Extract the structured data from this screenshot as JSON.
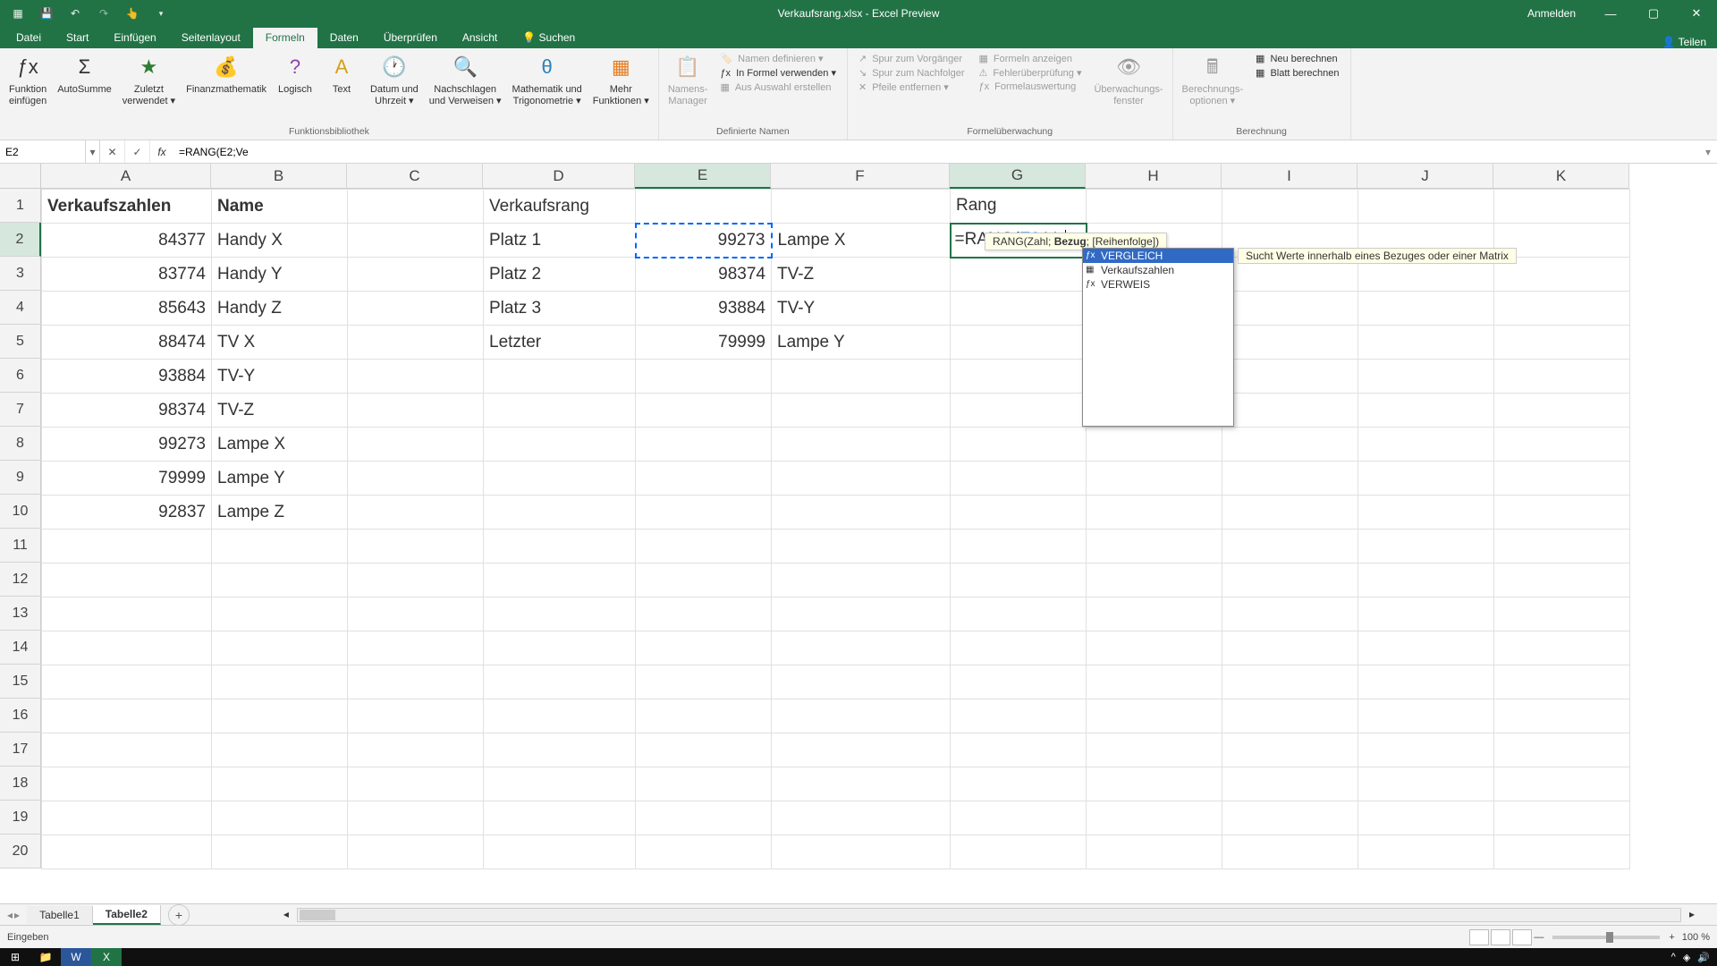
{
  "titlebar": {
    "title": "Verkaufsrang.xlsx - Excel Preview",
    "signin": "Anmelden"
  },
  "ribbonTabs": {
    "file": "Datei",
    "home": "Start",
    "insert": "Einfügen",
    "pageLayout": "Seitenlayout",
    "formulas": "Formeln",
    "data": "Daten",
    "review": "Überprüfen",
    "view": "Ansicht",
    "search": "Suchen",
    "share": "Teilen"
  },
  "ribbon": {
    "insertFn": "Funktion\neinfügen",
    "autosum": "AutoSumme",
    "recent": "Zuletzt\nverwendet ▾",
    "financial": "Finanzmathematik",
    "logical": "Logisch",
    "text": "Text",
    "dateTime": "Datum und\nUhrzeit ▾",
    "lookup": "Nachschlagen\nund Verweisen ▾",
    "mathTrig": "Mathematik und\nTrigonometrie ▾",
    "moreFn": "Mehr\nFunktionen ▾",
    "fnLib": "Funktionsbibliothek",
    "nameMgr": "Namens-\nManager",
    "defineName": "Namen definieren ▾",
    "useInFormula": "In Formel verwenden ▾",
    "createFromSel": "Aus Auswahl erstellen",
    "definedNames": "Definierte Namen",
    "tracePrec": "Spur zum Vorgänger",
    "traceDep": "Spur zum Nachfolger",
    "removeArrows": "Pfeile entfernen ▾",
    "showFormulas": "Formeln anzeigen",
    "errorCheck": "Fehlerüberprüfung ▾",
    "evalFormula": "Formelauswertung",
    "auditing": "Formelüberwachung",
    "watchWin": "Überwachungs-\nfenster",
    "calcOpts": "Berechnungs-\noptionen ▾",
    "calcNow": "Neu berechnen",
    "calcSheet": "Blatt berechnen",
    "calculation": "Berechnung"
  },
  "fxbar": {
    "nameBox": "E2",
    "formula": "=RANG(E2;Ve"
  },
  "cols": [
    "A",
    "B",
    "C",
    "D",
    "E",
    "F",
    "G",
    "H",
    "I",
    "J",
    "K"
  ],
  "headers": {
    "a1": "Verkaufszahlen",
    "b1": "Name",
    "d1": "Verkaufsrang",
    "g1": "Rang"
  },
  "dataA": [
    84377,
    83774,
    85643,
    88474,
    93884,
    98374,
    99273,
    79999,
    92837
  ],
  "dataB": [
    "Handy X",
    "Handy Y",
    "Handy Z",
    "TV X",
    "TV-Y",
    "TV-Z",
    "Lampe X",
    "Lampe Y",
    "Lampe Z"
  ],
  "dataD": [
    "Platz 1",
    "Platz 2",
    "Platz 3",
    "Letzter"
  ],
  "dataE": [
    "99273",
    "98374",
    "93884",
    "79999"
  ],
  "dataF": [
    "Lampe X",
    "TV-Z",
    "TV-Y",
    "Lampe Y"
  ],
  "g2_prefix": "=RANG(",
  "g2_ref": "E2",
  "g2_suffix": ";Ve",
  "tooltip": {
    "fn": "RANG(",
    "arg1": "Zahl; ",
    "arg2": "Bezug",
    "arg3": "; [Reihenfolge])"
  },
  "autocomplete": {
    "item1": "VERGLEICH",
    "item2": "Verkaufszahlen",
    "item3": "VERWEIS",
    "desc": "Sucht Werte innerhalb eines Bezuges oder einer Matrix"
  },
  "sheetTabs": {
    "t1": "Tabelle1",
    "t2": "Tabelle2"
  },
  "status": {
    "mode": "Eingeben",
    "zoom": "100 %"
  }
}
